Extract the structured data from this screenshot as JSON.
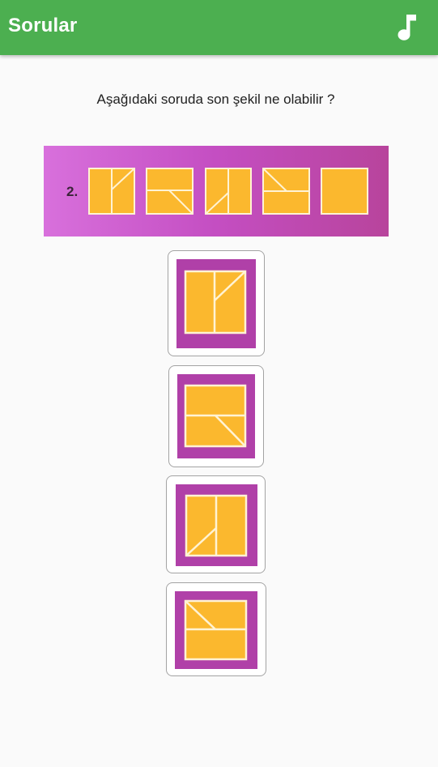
{
  "appbar": {
    "title": "Sorular",
    "music_icon": "music-note-icon",
    "color": "#4caf50"
  },
  "question": {
    "text": "Aşağıdaki soruda son şekil ne olabilir ?",
    "number_label": "2."
  },
  "colors": {
    "purple_frame": "#b040a8",
    "strip_bg": "#c84fc4",
    "square_fill": "#fbb82e",
    "square_line": "#fff3d4"
  },
  "options": [
    {
      "name": "option-1",
      "pattern": "vertical split with top-right diagonal"
    },
    {
      "name": "option-2",
      "pattern": "horizontal split with bottom diagonal"
    },
    {
      "name": "option-3",
      "pattern": "vertical split with bottom-left diagonal"
    },
    {
      "name": "option-4",
      "pattern": "horizontal split with top-left diagonal"
    }
  ]
}
